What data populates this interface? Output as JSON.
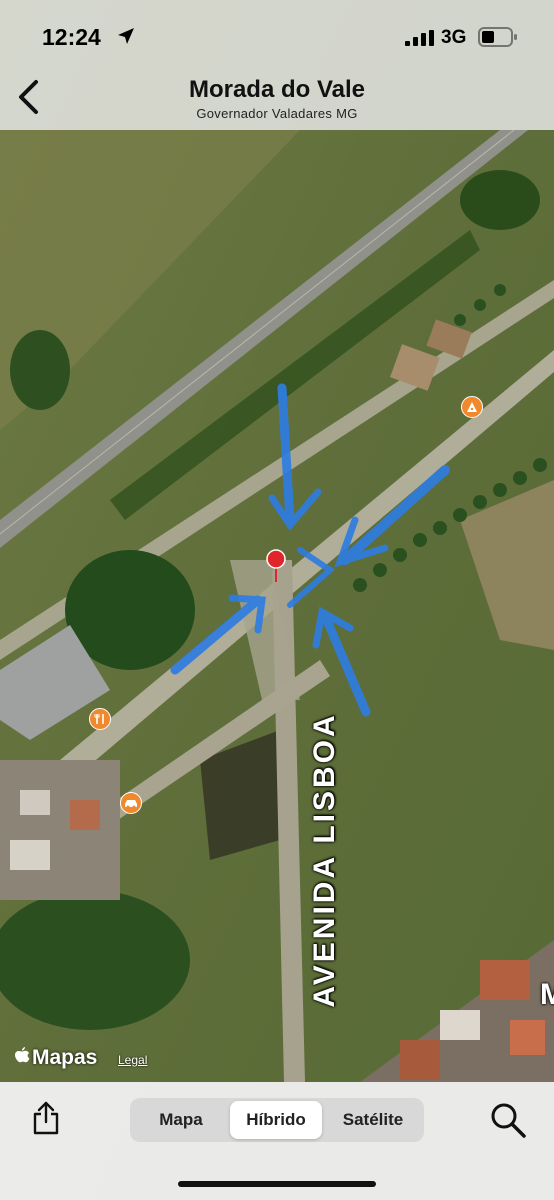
{
  "status_bar": {
    "time": "12:24",
    "network": "3G",
    "icons": [
      "location-arrow-icon",
      "signal-bars-icon",
      "battery-icon"
    ]
  },
  "nav": {
    "title": "Morada do Vale",
    "subtitle": "Governador Valadares MG",
    "back_icon": "chevron-left-icon"
  },
  "map": {
    "street_label": "AVENIDA LISBOA",
    "street_label_cut": "M",
    "brand": "Mapas",
    "legal": "Legal",
    "pin_color": "#e0252b",
    "annotation_color": "#2f7de1",
    "poi_color": "#f0892d",
    "pois": [
      "pizza-icon",
      "restaurant-icon",
      "car-icon"
    ]
  },
  "toolbar": {
    "share_icon": "share-icon",
    "segments": [
      "Mapa",
      "Híbrido",
      "Satélite"
    ],
    "selected": "Híbrido",
    "search_icon": "magnifier-icon"
  }
}
